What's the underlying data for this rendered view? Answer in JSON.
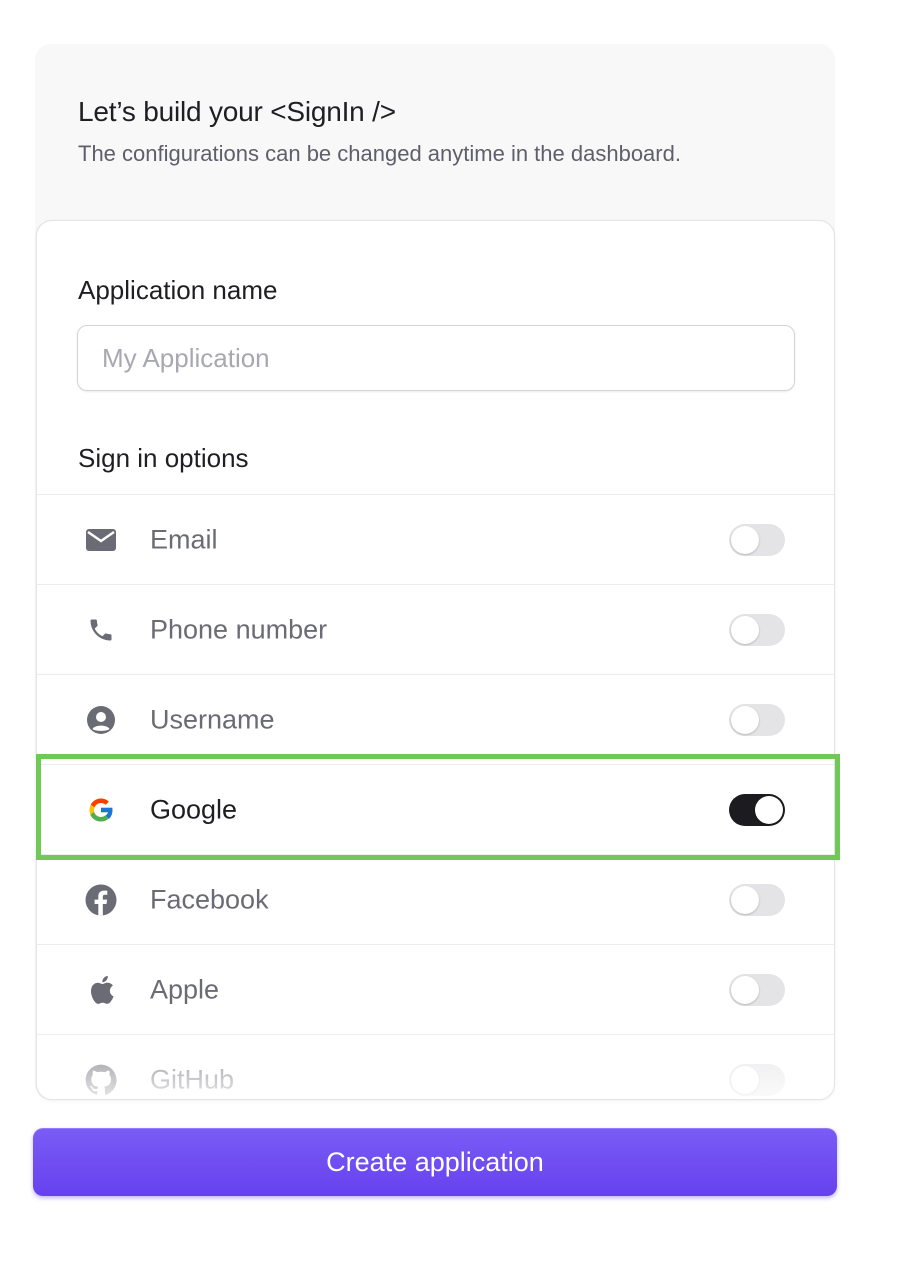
{
  "header": {
    "title": "Let’s build your <SignIn />",
    "subtitle": "The configurations can be changed anytime in the dashboard."
  },
  "form": {
    "app_name_label": "Application name",
    "app_name_placeholder": "My Application",
    "app_name_value": "",
    "sign_in_options_label": "Sign in options",
    "options": [
      {
        "label": "Email",
        "icon": "envelope-icon",
        "enabled": false
      },
      {
        "label": "Phone number",
        "icon": "phone-icon",
        "enabled": false
      },
      {
        "label": "Username",
        "icon": "user-circle-icon",
        "enabled": false
      },
      {
        "label": "Google",
        "icon": "google-icon",
        "enabled": true
      },
      {
        "label": "Facebook",
        "icon": "facebook-icon",
        "enabled": false
      },
      {
        "label": "Apple",
        "icon": "apple-icon",
        "enabled": false
      },
      {
        "label": "GitHub",
        "icon": "github-icon",
        "enabled": false
      }
    ]
  },
  "actions": {
    "create_label": "Create application"
  },
  "colors": {
    "accent": "#6b4df2",
    "highlight": "#70c957",
    "toggle_on": "#1c1c20",
    "toggle_off": "#e4e4e7"
  }
}
